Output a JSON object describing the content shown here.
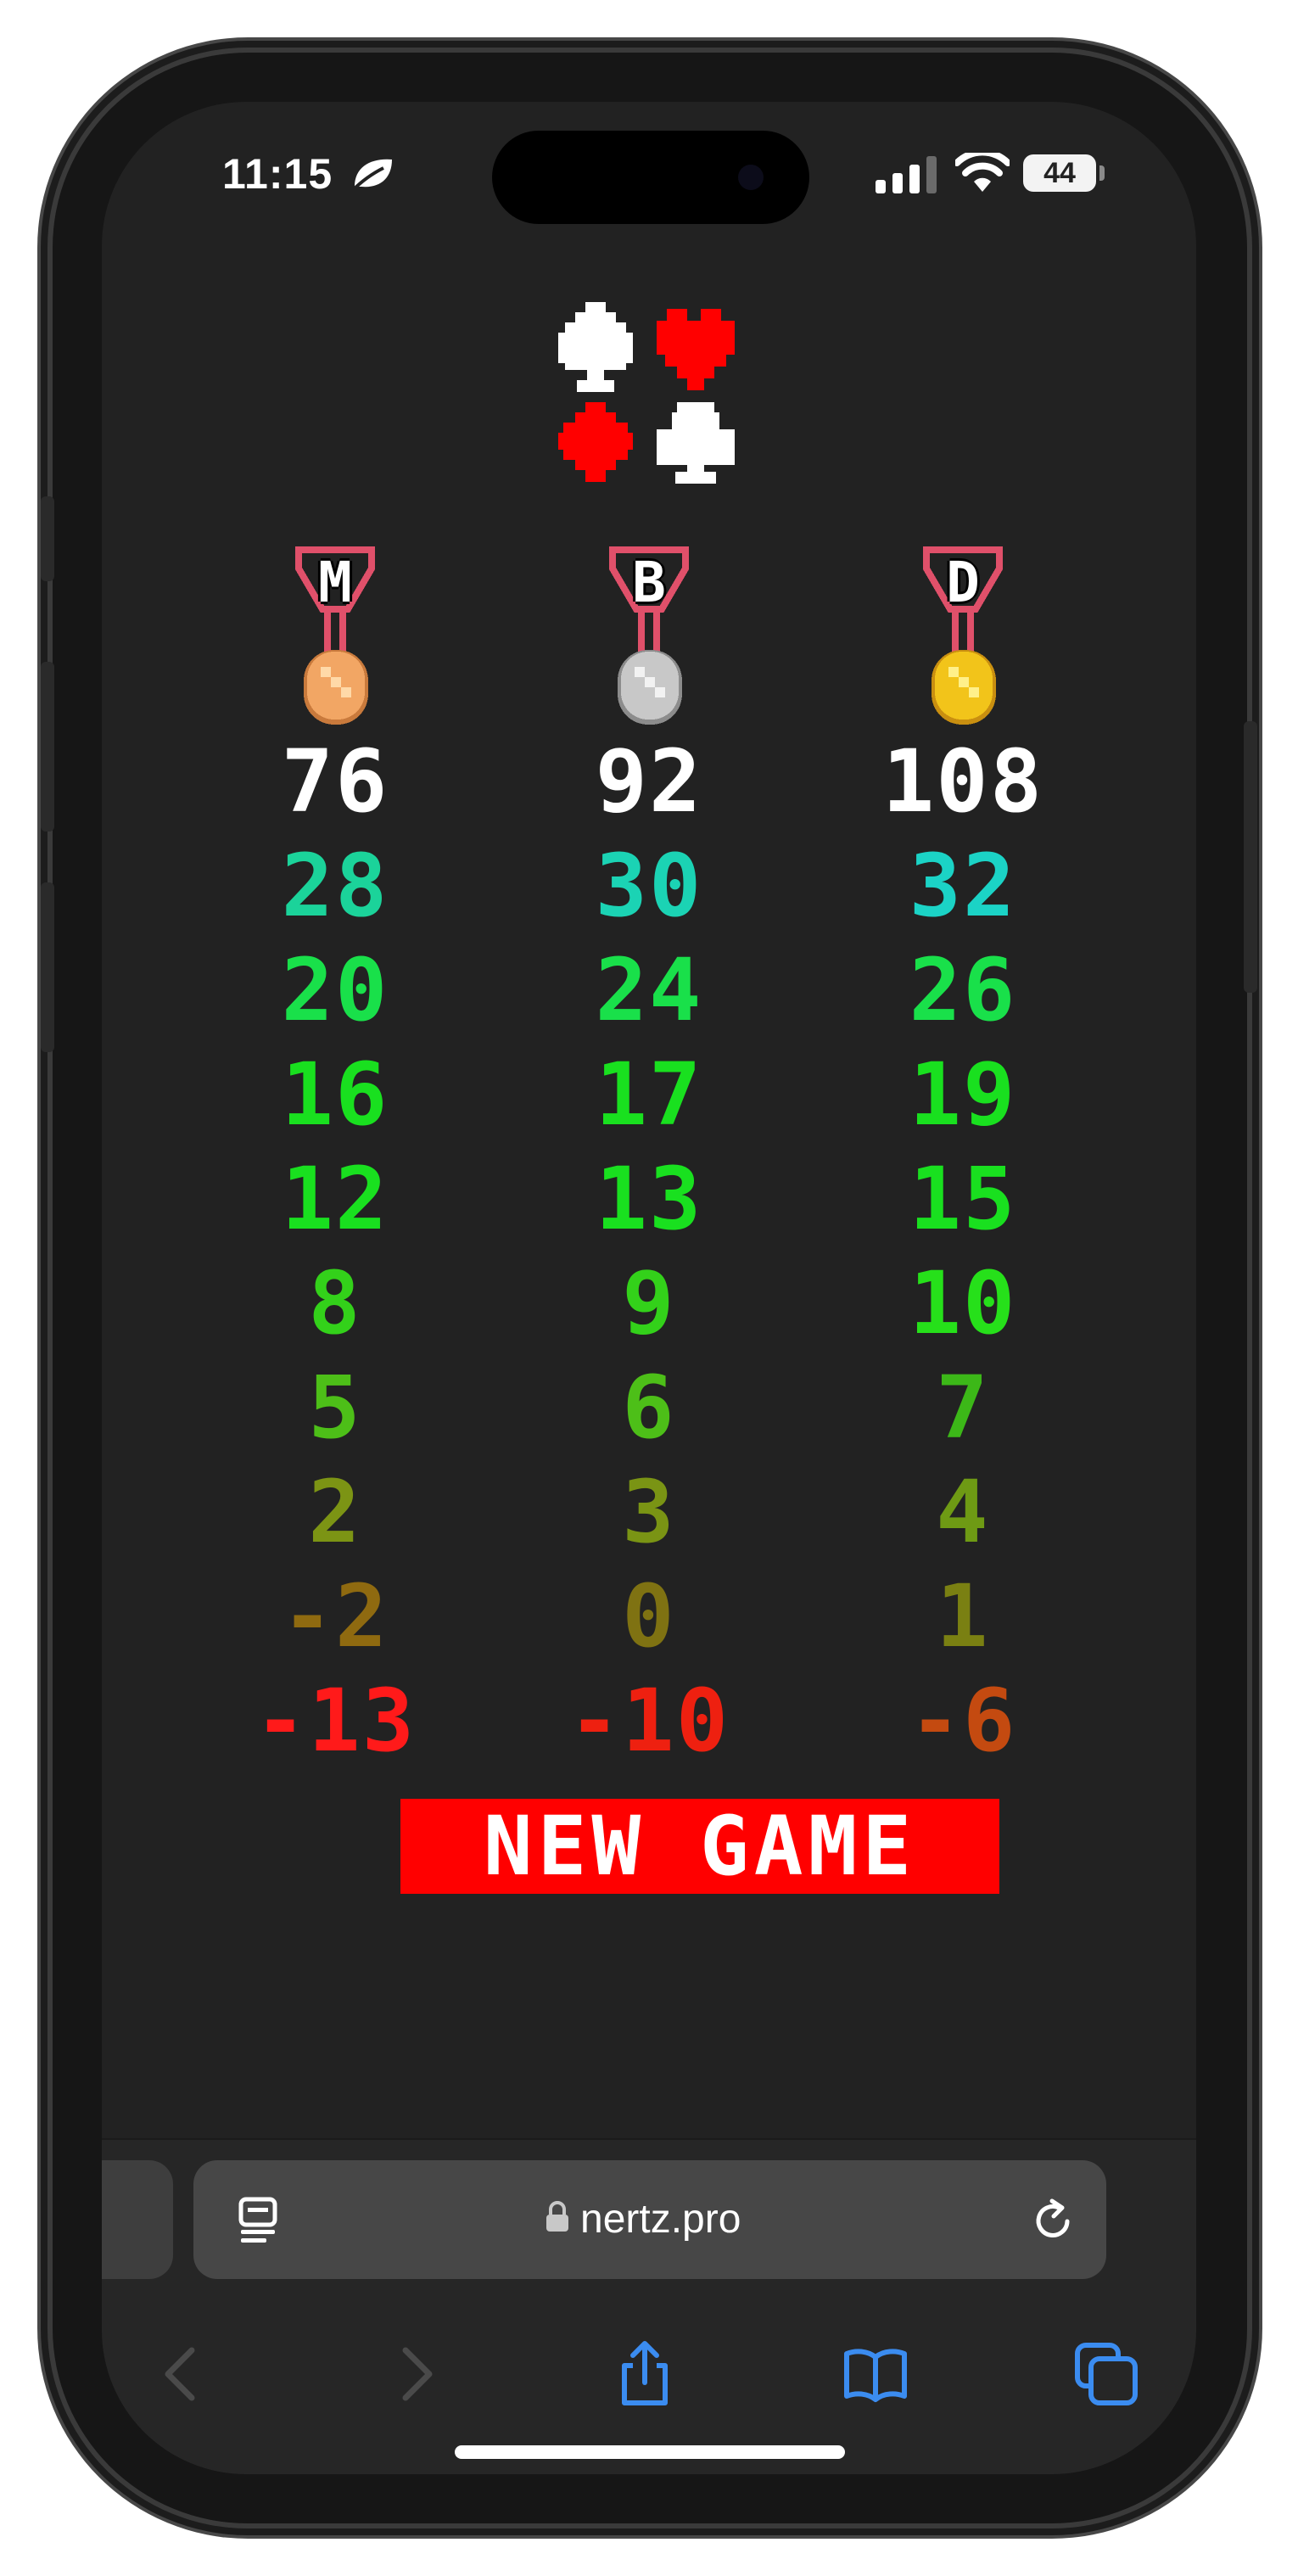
{
  "status_bar": {
    "time": "11:15",
    "battery": "44"
  },
  "players": [
    {
      "initial": "M",
      "medal": "bronze",
      "total": "76",
      "rounds": [
        "28",
        "20",
        "16",
        "12",
        "8",
        "5",
        "2",
        "-2",
        "-13"
      ],
      "round_colors": [
        "#1bd39a",
        "#19e04a",
        "#19e01f",
        "#19e01f",
        "#33d11a",
        "#4dbf18",
        "#7c9414",
        "#8f6a10",
        "#ff1a1a"
      ]
    },
    {
      "initial": "B",
      "medal": "silver",
      "total": "92",
      "rounds": [
        "30",
        "24",
        "17",
        "13",
        "9",
        "6",
        "3",
        "0",
        "-10"
      ],
      "round_colors": [
        "#1bd3b4",
        "#19e04a",
        "#19e01f",
        "#19e01f",
        "#33d11a",
        "#4dbf18",
        "#7a9414",
        "#7f7212",
        "#ee2010"
      ]
    },
    {
      "initial": "D",
      "medal": "gold",
      "total": "108",
      "rounds": [
        "32",
        "26",
        "19",
        "15",
        "10",
        "7",
        "4",
        "1",
        "-6"
      ],
      "round_colors": [
        "#1bd3c6",
        "#19e04a",
        "#19e01f",
        "#19e01f",
        "#26e01a",
        "#3cb818",
        "#6e9a14",
        "#7a8012",
        "#c44a10"
      ]
    }
  ],
  "new_game_label": "NEW GAME",
  "browser": {
    "url": "nertz.pro"
  },
  "colors": {
    "background": "#222222",
    "accent_red": "#ff0000",
    "safari_blue": "#3b8cf0"
  },
  "icons": [
    "spade-icon",
    "heart-icon",
    "diamond-icon",
    "club-icon",
    "leaf-icon",
    "signal-icon",
    "wifi-icon",
    "reader-icon",
    "lock-icon",
    "reload-icon",
    "back-icon",
    "forward-icon",
    "share-icon",
    "bookmarks-icon",
    "tabs-icon"
  ]
}
